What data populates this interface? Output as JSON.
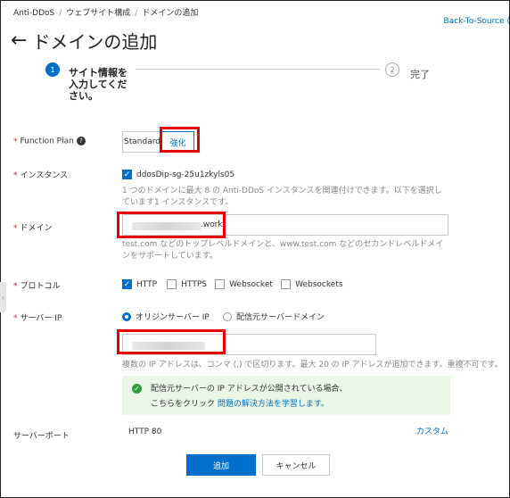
{
  "breadcrumb": {
    "items": [
      "Anti-DDoS",
      "ウェブサイト構成",
      "ドメインの追加"
    ]
  },
  "header": {
    "back_to_source": "Back-To-Source (",
    "title": "ドメインの追加"
  },
  "steps": [
    {
      "number": "1",
      "label": "サイト情報を入力してください。"
    },
    {
      "number": "2",
      "label": "完了"
    }
  ],
  "form": {
    "function_plan": {
      "label": "Function Plan",
      "options": [
        "Standard",
        "強化"
      ],
      "selected": "強化"
    },
    "instance": {
      "label": "インスタンス",
      "value": "ddosDip-sg-25u1zkyls05",
      "checked": true,
      "hint": "1 つのドメインに最大 8 の Anti-DDoS インスタンスを関連付けできます。以下を選択しています1 インスタンスです。"
    },
    "domain": {
      "label": "ドメイン",
      "value_suffix": ".work",
      "hint": "test.com などのトップレベルドメインと、www.test.com などのセカンドレベルドメインをサポートしています。"
    },
    "protocol": {
      "label": "プロトコル",
      "options": [
        {
          "label": "HTTP",
          "checked": true
        },
        {
          "label": "HTTPS",
          "checked": false
        },
        {
          "label": "Websocket",
          "checked": false
        },
        {
          "label": "Websockets",
          "checked": false
        }
      ]
    },
    "server_ip": {
      "label": "サーバー IP",
      "options": [
        {
          "label": "オリジンサーバー IP",
          "selected": true
        },
        {
          "label": "配信元サーバードメイン",
          "selected": false
        }
      ],
      "hint": "複数の IP アドレスは、コンマ (,) で区切ります。最大 20 の IP アドレスが追加できます。重複不可です。",
      "info_line1": "配信元サーバーの IP アドレスが公開されている場合、",
      "info_line2_prefix": "こちらをクリック",
      "info_link": "問題の解決方法を学習します。"
    },
    "server_port": {
      "label": "サーバーポート",
      "value": "HTTP 80",
      "custom_link": "カスタム"
    }
  },
  "actions": {
    "add": "追加",
    "cancel": "キャンセル"
  },
  "colors": {
    "accent": "#0070cc",
    "highlight": "#e60000",
    "required": "#e02020",
    "info_bg": "#eaf6e6",
    "success": "#2e9e3e"
  }
}
